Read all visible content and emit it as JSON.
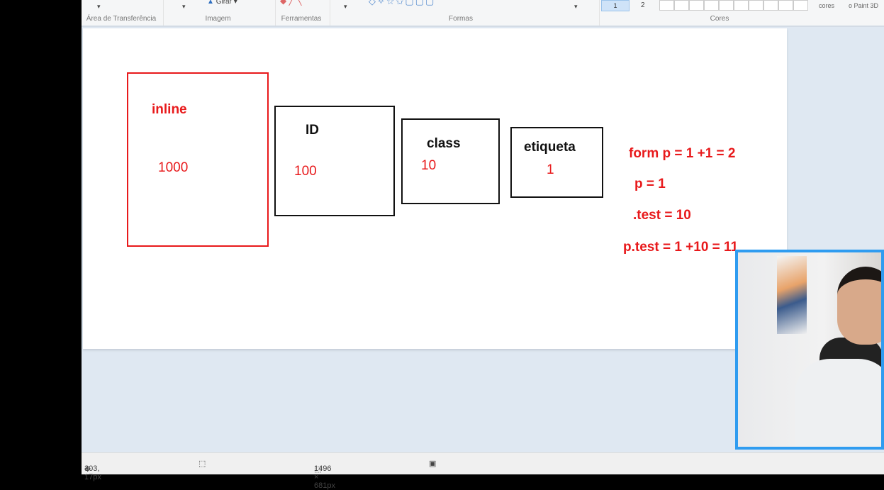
{
  "ribbon": {
    "groups": [
      "Área de Transferência",
      "Imagem",
      "Ferramentas",
      "Formas",
      "Cores"
    ],
    "rotate_label": "Girar",
    "sizes": [
      "1",
      "2"
    ],
    "edit_colors": "cores",
    "paint3d": "o Paint 3D"
  },
  "canvas": {
    "boxes": [
      {
        "title": "inline",
        "value": "1000",
        "border_color": "#e8191b"
      },
      {
        "title": "ID",
        "value": "100",
        "border_color": "#111111"
      },
      {
        "title": "class",
        "value": "10",
        "border_color": "#111111"
      },
      {
        "title": "etiqueta",
        "value": "1",
        "border_color": "#111111"
      }
    ],
    "notes": [
      "form p = 1 +1 = 2",
      "p = 1",
      ".test = 10",
      "p.test = 1 +10 = 11"
    ]
  },
  "status": {
    "cursor": "303, 17px",
    "size": "1496 × 681px"
  },
  "colors": {
    "accent": "#e8191b",
    "webcam_border": "#2f9cf0"
  }
}
